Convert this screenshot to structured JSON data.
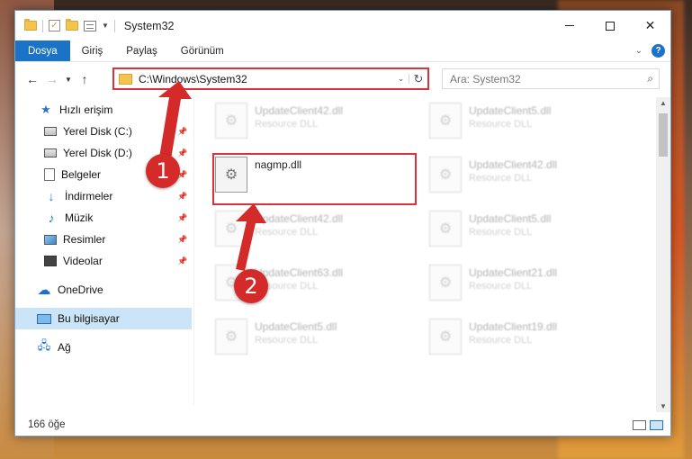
{
  "window": {
    "title": "System32",
    "tabs": [
      "Dosya",
      "Giriş",
      "Paylaş",
      "Görünüm"
    ],
    "help_glyph": "?"
  },
  "navbar": {
    "address": "C:\\Windows\\System32",
    "search_placeholder": "Ara: System32"
  },
  "sidebar": {
    "items": [
      {
        "label": "Hızlı erişim",
        "icon": "star-icon",
        "pinned": false
      },
      {
        "label": "Yerel Disk (C:)",
        "icon": "disk-icon",
        "pinned": true
      },
      {
        "label": "Yerel Disk (D:)",
        "icon": "disk-icon",
        "pinned": true
      },
      {
        "label": "Belgeler",
        "icon": "document-icon",
        "pinned": true
      },
      {
        "label": "İndirmeler",
        "icon": "download-icon",
        "pinned": true
      },
      {
        "label": "Müzik",
        "icon": "music-icon",
        "pinned": true
      },
      {
        "label": "Resimler",
        "icon": "pictures-icon",
        "pinned": true
      },
      {
        "label": "Videolar",
        "icon": "video-icon",
        "pinned": true
      },
      {
        "label": "OneDrive",
        "icon": "cloud-icon",
        "pinned": false
      },
      {
        "label": "Bu bilgisayar",
        "icon": "computer-icon",
        "pinned": false,
        "selected": true
      },
      {
        "label": "Ağ",
        "icon": "network-icon",
        "pinned": false
      }
    ]
  },
  "files": {
    "left": [
      {
        "name": "UpdateClient42.dll",
        "type": "Resource DLL"
      },
      {
        "name": "nagmp.dll",
        "type": ""
      },
      {
        "name": "UpdateClient42.dll",
        "type": "Resource DLL"
      },
      {
        "name": "UpdateClient63.dll",
        "type": "Resource DLL"
      },
      {
        "name": "UpdateClient5.dll",
        "type": "Resource DLL"
      }
    ],
    "right": [
      {
        "name": "UpdateClient5.dll",
        "type": "Resource DLL"
      },
      {
        "name": "UpdateClient42.dll",
        "type": "Resource DLL"
      },
      {
        "name": "UpdateClient5.dll",
        "type": "Resource DLL"
      },
      {
        "name": "UpdateClient21.dll",
        "type": "Resource DLL"
      },
      {
        "name": "UpdateClient19.dll",
        "type": "Resource DLL"
      }
    ]
  },
  "status": {
    "count": "166 öğe"
  },
  "markers": {
    "step1": "1",
    "step2": "2"
  },
  "colors": {
    "accent": "#1a73c7",
    "highlight": "#d9323a",
    "marker": "#d42a2a"
  }
}
